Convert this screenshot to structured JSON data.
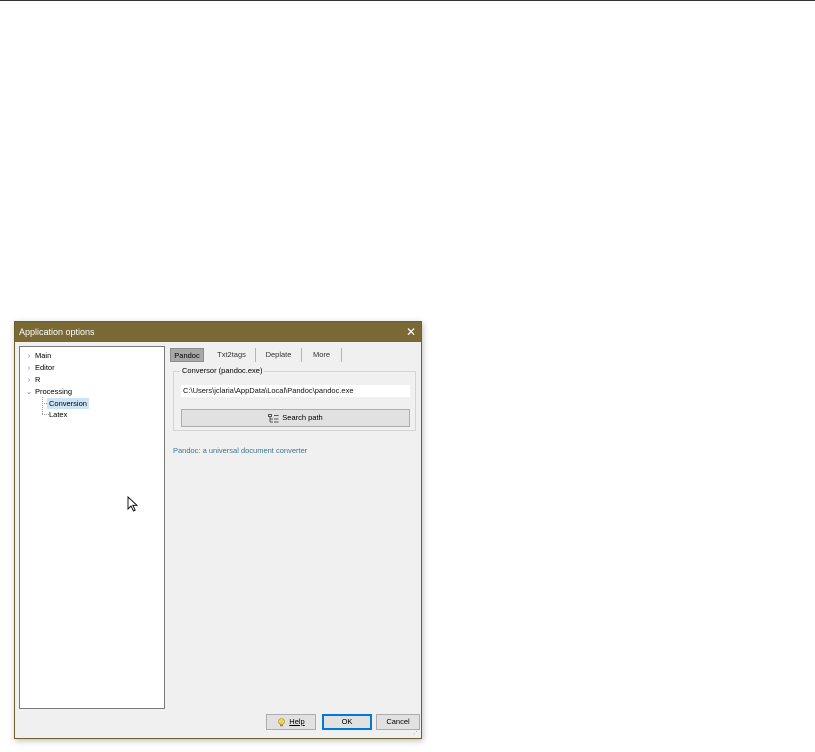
{
  "dialog": {
    "title": "Application options",
    "close_glyph": "✕"
  },
  "tree": {
    "items": [
      {
        "label": "Main",
        "expander": "chevron-right"
      },
      {
        "label": "Editor",
        "expander": "chevron-right"
      },
      {
        "label": "R",
        "expander": "chevron-right"
      },
      {
        "label": "Processing",
        "expander": "chevron-down"
      },
      {
        "label": "Conversion",
        "selected": true
      },
      {
        "label": "Latex"
      }
    ],
    "glyph_collapsed": "›",
    "glyph_expanded": "⌄"
  },
  "tabs": [
    {
      "label": "Pandoc",
      "active": true
    },
    {
      "label": "Txt2tags"
    },
    {
      "label": "Deplate"
    },
    {
      "label": "More"
    }
  ],
  "conversor": {
    "legend": "Conversor (pandoc.exe)",
    "path": "C:\\Users\\jclaria\\AppData\\Local\\Pandoc\\pandoc.exe",
    "search_label": "Search path",
    "search_icon": "folder-tree-icon"
  },
  "link_text": "Pandoc: a universal document converter",
  "buttons": {
    "help": "Help",
    "help_icon": "lightbulb-icon",
    "ok": "OK",
    "cancel": "Cancel"
  },
  "colors": {
    "titlebar": "#7a6934",
    "selection": "#cce4f7",
    "link": "#3a7790",
    "default_button_border": "#0078d7"
  }
}
